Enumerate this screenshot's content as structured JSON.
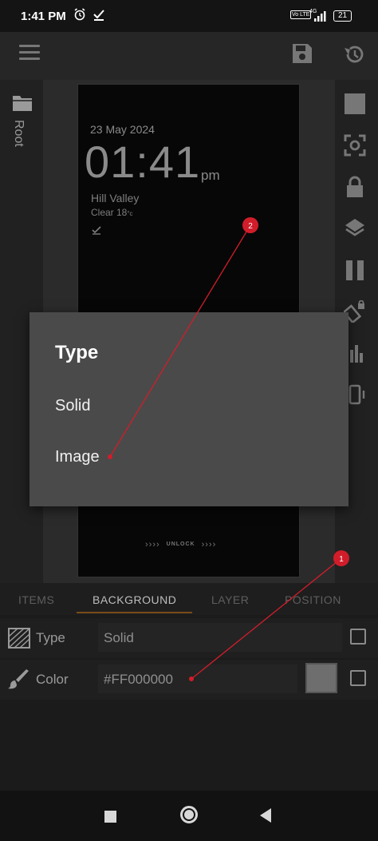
{
  "status_bar": {
    "time": "1:41 PM",
    "volte": "Vo LTE",
    "network": "4G",
    "battery": "21"
  },
  "toolbar": {
    "menu_icon": "hamburger-icon",
    "save_icon": "save-icon",
    "history_icon": "history-icon"
  },
  "left_panel": {
    "folder_icon": "folder-icon",
    "root_label": "Root"
  },
  "preview": {
    "date": "23 May 2024",
    "time": "01:41",
    "ampm": "pm",
    "city": "Hill Valley",
    "weather_text": "Clear 18",
    "weather_unit": "°c",
    "unlock_left": "››››",
    "unlock_text": "UNLOCK",
    "unlock_right": "››››"
  },
  "right_rail_icons": [
    "stop-icon",
    "screenshot-icon",
    "lock-icon",
    "layers-icon",
    "pause-icon",
    "rotate-lock-icon",
    "equalizer-icon",
    "vibrate-icon"
  ],
  "tabs": [
    {
      "label": "ITEMS",
      "active": false
    },
    {
      "label": "BACKGROUND",
      "active": true
    },
    {
      "label": "LAYER",
      "active": false
    },
    {
      "label": "POSITION",
      "active": false
    }
  ],
  "properties": {
    "type": {
      "label": "Type",
      "value": "Solid"
    },
    "color": {
      "label": "Color",
      "value": "#FF000000"
    }
  },
  "dialog": {
    "title": "Type",
    "options": [
      "Solid",
      "Image"
    ]
  },
  "annotations": [
    {
      "number": "1"
    },
    {
      "number": "2"
    }
  ],
  "colors": {
    "accent_underline": "#7a4c18",
    "annotation_red": "#d11d2a",
    "dialog_bg": "#4a4a4a"
  }
}
